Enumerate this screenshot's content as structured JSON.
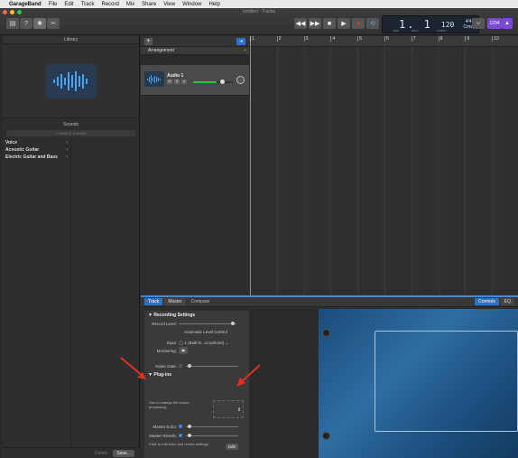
{
  "menubar": {
    "items": [
      "GarageBand",
      "File",
      "Edit",
      "Track",
      "Record",
      "Mix",
      "Share",
      "View",
      "Window",
      "Help"
    ]
  },
  "window": {
    "title": "Untitled - Tracks"
  },
  "lcd": {
    "position": "1. 1",
    "tempo": "120",
    "signature": "4/4",
    "key": "Cmaj",
    "label_bar": "BAR",
    "label_beat": "BEAT",
    "label_tempo": "TEMPO"
  },
  "toolbar": {
    "count_in": "1234"
  },
  "library": {
    "header": "Library",
    "sounds_header": "Sounds",
    "search_placeholder": "Search Sounds",
    "items": [
      {
        "label": "Voice"
      },
      {
        "label": "Acoustic Guitar"
      },
      {
        "label": "Electric Guitar and Bass"
      }
    ],
    "delete_label": "Delete",
    "save_label": "Save..."
  },
  "tracks": {
    "arrangement_label": "Arrangement",
    "track_name": "Audio 1"
  },
  "ruler": {
    "marks": [
      "1",
      "2",
      "3",
      "4",
      "5",
      "6",
      "7",
      "8",
      "9",
      "10"
    ]
  },
  "smart_controls": {
    "tabs": [
      "Track",
      "Master",
      "Compare"
    ],
    "right_tabs": [
      "Controls",
      "EQ"
    ],
    "recording_settings_title": "Recording Settings",
    "record_level_label": "Record Level:",
    "auto_level_label": "Automatic Level Control",
    "input_label": "Input:",
    "input_value": "1 (Built-in...icrophone)",
    "monitoring_label": "Monitoring:",
    "noise_gate_label": "Noise Gate:",
    "plugins_title": "Plug-ins",
    "plugins_note": "Use to change the sound processing.",
    "master_echo_label": "Master Echo:",
    "master_reverb_label": "Master Reverb:",
    "click_note": "Click to edit echo and reverb settings.",
    "edit_label": "Edit"
  },
  "colors": {
    "accent": "#2a72c8",
    "count_in": "#7a4bd0",
    "annotation_arrow": "#e2311d"
  }
}
